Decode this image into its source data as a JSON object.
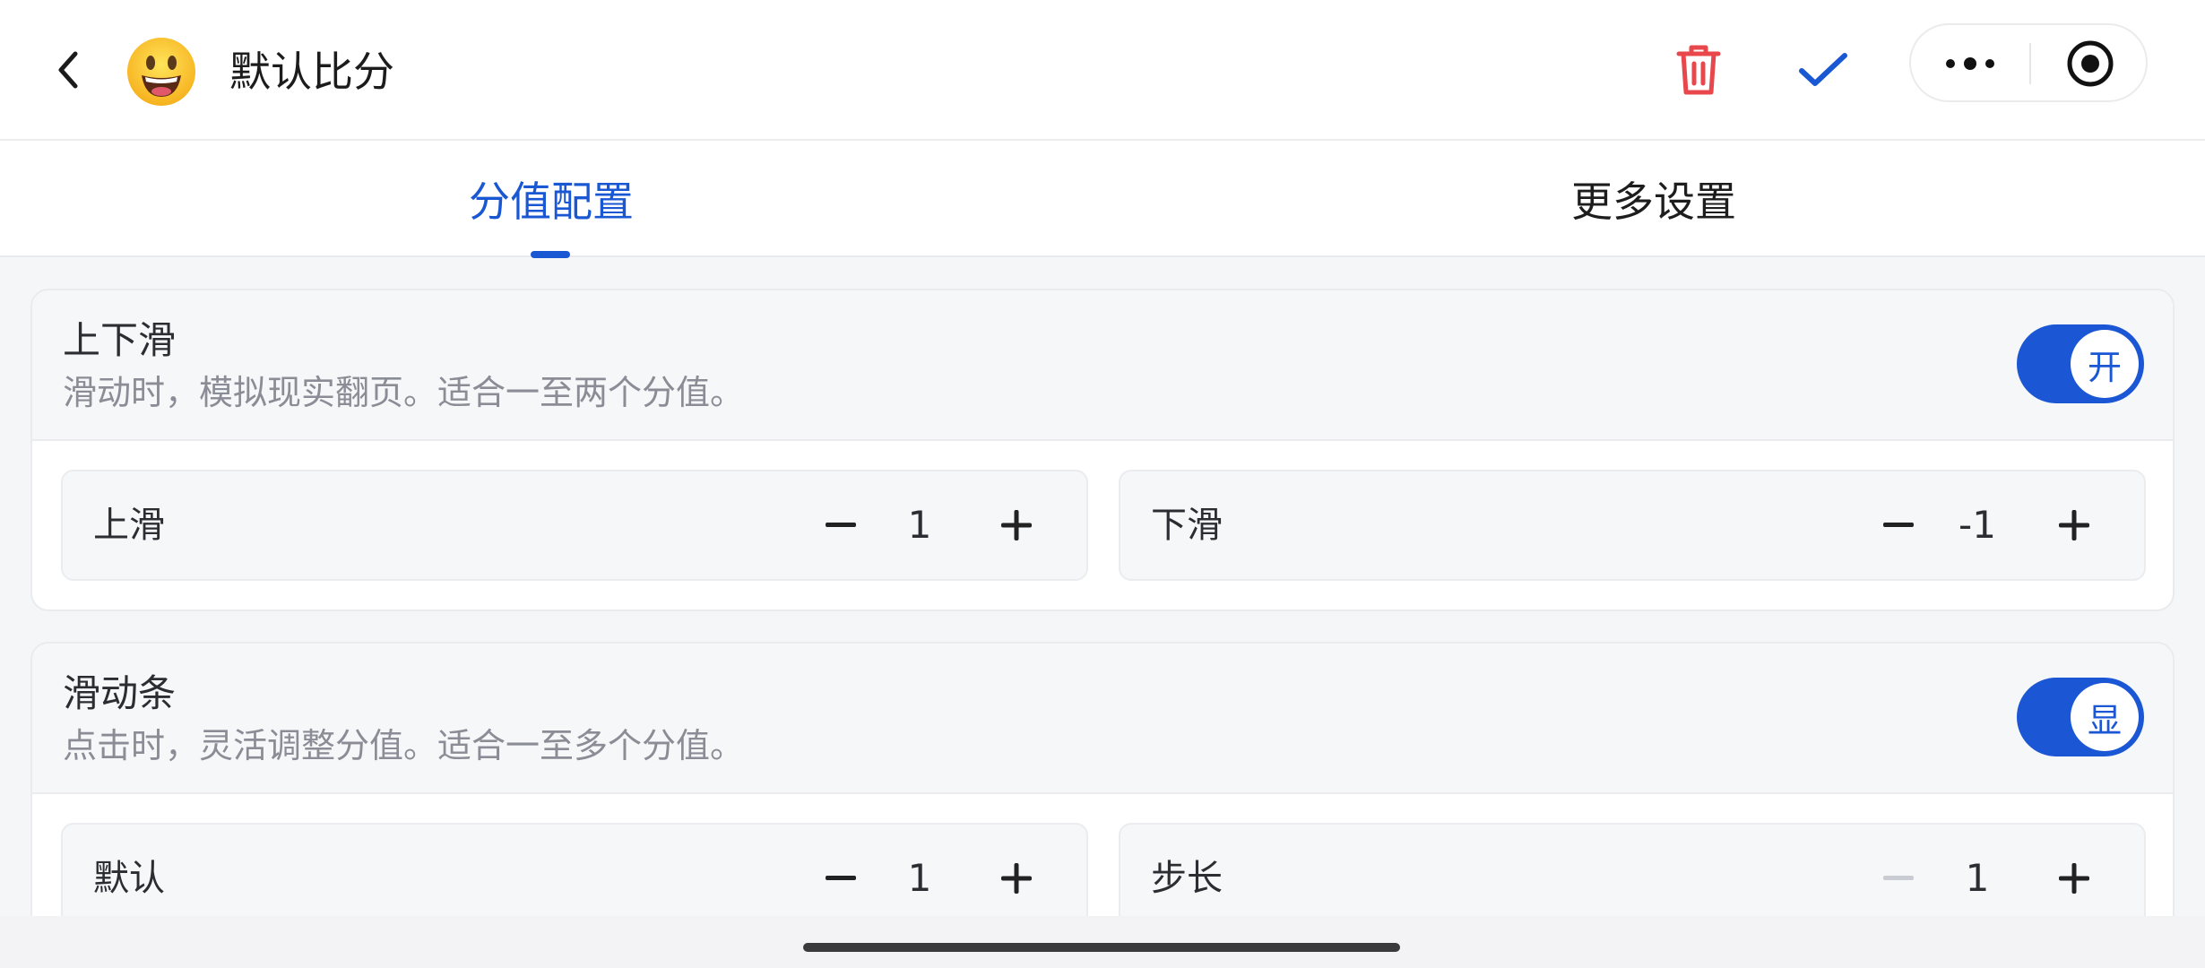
{
  "header": {
    "title": "默认比分",
    "emoji": "😀",
    "icons": {
      "back": "chevron-left-icon",
      "delete": "trash-icon",
      "confirm": "check-icon",
      "more": "more-dots-icon",
      "close": "target-circle-icon"
    },
    "colors": {
      "delete": "#e8484b",
      "confirm": "#1a57d2"
    }
  },
  "tabs": [
    {
      "label": "分值配置",
      "active": true
    },
    {
      "label": "更多设置",
      "active": false
    }
  ],
  "sections": [
    {
      "title": "上下滑",
      "description": "滑动时，模拟现实翻页。适合一至两个分值。",
      "toggle": {
        "label": "开",
        "on": true
      },
      "steppers": [
        {
          "label": "上滑",
          "value": "1",
          "minus_enabled": true
        },
        {
          "label": "下滑",
          "value": "-1",
          "minus_enabled": true
        }
      ]
    },
    {
      "title": "滑动条",
      "description": "点击时，灵活调整分值。适合一至多个分值。",
      "toggle": {
        "label": "显",
        "on": true
      },
      "steppers": [
        {
          "label": "默认",
          "value": "1",
          "minus_enabled": true
        },
        {
          "label": "步长",
          "value": "1",
          "minus_enabled": false
        }
      ]
    }
  ],
  "colors": {
    "accent": "#1a57d2",
    "toggle": "#1b57d4",
    "disabled": "#c9ccd2"
  }
}
